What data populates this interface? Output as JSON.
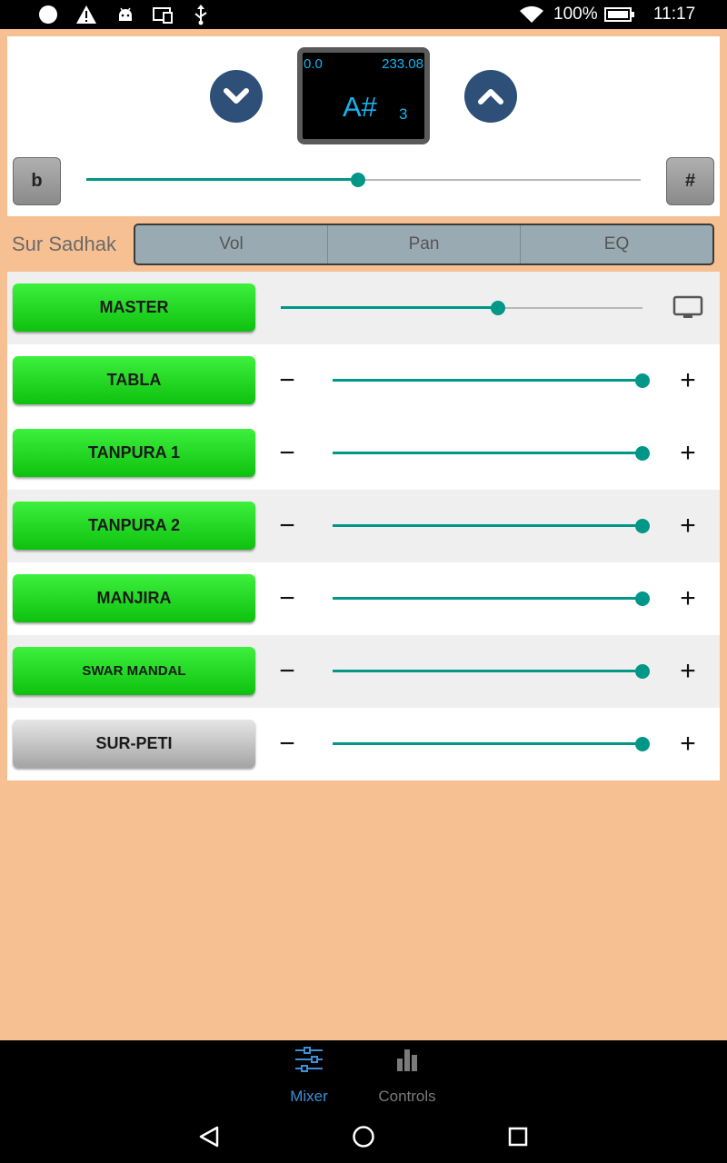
{
  "status_bar": {
    "battery_percent": "100%",
    "time": "11:17",
    "icons": [
      "circle-icon",
      "warning-icon",
      "android-icon",
      "cast-icon",
      "usb-icon",
      "wifi-icon",
      "battery-icon"
    ]
  },
  "tuner": {
    "cents": "0.0",
    "frequency": "233.08",
    "note": "A#",
    "octave": "3",
    "flat_label": "b",
    "sharp_label": "#",
    "fine_tune_fraction": 0.49
  },
  "title": "Sur Sadhak",
  "tabs": [
    {
      "label": "Vol",
      "active": true
    },
    {
      "label": "Pan",
      "active": false
    },
    {
      "label": "EQ",
      "active": false
    }
  ],
  "master": {
    "label": "MASTER",
    "volume_fraction": 0.6
  },
  "channels": [
    {
      "label": "TABLA",
      "volume_fraction": 1.0,
      "enabled": true
    },
    {
      "label": "TANPURA 1",
      "volume_fraction": 1.0,
      "enabled": true
    },
    {
      "label": "TANPURA 2",
      "volume_fraction": 1.0,
      "enabled": true
    },
    {
      "label": "MANJIRA",
      "volume_fraction": 1.0,
      "enabled": true
    },
    {
      "label": "SWAR MANDAL",
      "volume_fraction": 1.0,
      "enabled": true
    },
    {
      "label": "SUR-PETI",
      "volume_fraction": 1.0,
      "enabled": false
    }
  ],
  "bottom_nav": [
    {
      "label": "Mixer",
      "active": true
    },
    {
      "label": "Controls",
      "active": false
    }
  ],
  "colors": {
    "accent": "#009688",
    "active_tab": "#c0200a",
    "background": "#f7c092",
    "nav_active": "#3d8fd6",
    "nav_inactive": "#7a7a7a",
    "display_text": "#14b4f0"
  }
}
